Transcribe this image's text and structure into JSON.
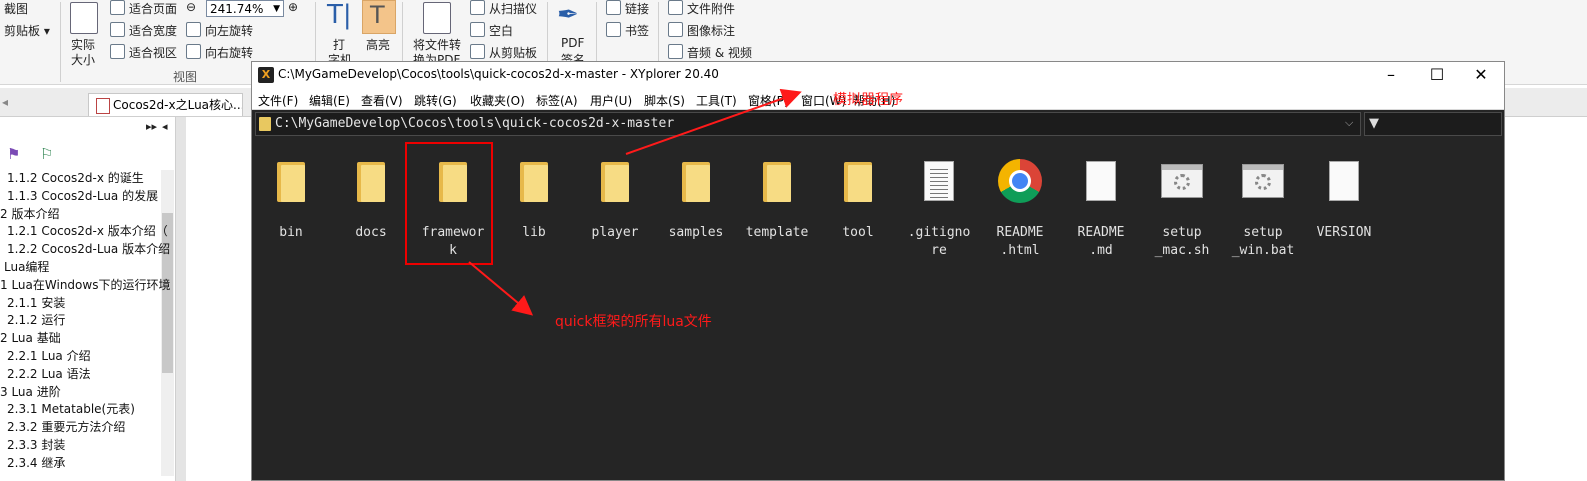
{
  "ribbon": {
    "screenshot": "截图",
    "clipboard": "剪贴板",
    "actual_size_1": "实际",
    "actual_size_2": "大小",
    "fit_page": "适合页面",
    "fit_width": "适合宽度",
    "fit_view": "适合视区",
    "zoom": "241.74%",
    "rotate_left": "向左旋转",
    "rotate_right": "向右旋转",
    "view_group": "视图",
    "typewriter_1": "打",
    "typewriter_2": "字机",
    "highlight": "高亮",
    "to_pdf_1": "将文件转",
    "to_pdf_2": "换为PDF",
    "from_scanner": "从扫描仪",
    "blank": "空白",
    "from_clipboard": "从剪贴板",
    "pdf_sign_1": "PDF",
    "pdf_sign_2": "签名",
    "link": "链接",
    "bookmark": "书签",
    "file_attachment": "文件附件",
    "image_annotation": "图像标注",
    "audio_video": "音频 & 视频"
  },
  "doc_tab": {
    "title": "Cocos2d-x之Lua核心..."
  },
  "outline": [
    "1.1.2 Cocos2d-x 的诞生",
    "1.1.3 Cocos2d-Lua 的发展",
    "2 版本介绍",
    "1.2.1 Cocos2d-x 版本介绍（",
    "1.2.2 Cocos2d-Lua 版本介绍",
    "Lua编程",
    "1 Lua在Windows下的运行环境",
    "2.1.1 安装",
    "2.1.2 运行",
    "2 Lua 基础",
    "2.2.1 Lua 介绍",
    "2.2.2 Lua 语法",
    "3 Lua 进阶",
    "2.3.1 Metatable(元表)",
    "2.3.2 重要元方法介绍",
    "2.3.3 封装",
    "2.3.4 继承"
  ],
  "window": {
    "title": "C:\\MyGameDevelop\\Cocos\\tools\\quick-cocos2d-x-master - XYplorer 20.40",
    "app_icon": "X",
    "minimize": "–",
    "maximize": "☐",
    "close": "✕"
  },
  "menu": [
    "文件(F)",
    "编辑(E)",
    "查看(V)",
    "跳转(G)",
    "收藏夹(O)",
    "标签(A)",
    "用户(U)",
    "脚本(S)",
    "工具(T)",
    "窗格(P)",
    "窗口(W)",
    "帮助(H)"
  ],
  "address": "C:\\MyGameDevelop\\Cocos\\tools\\quick-cocos2d-x-master",
  "files": [
    {
      "name": "bin",
      "type": "folder"
    },
    {
      "name": "docs",
      "type": "folder"
    },
    {
      "name": "framework",
      "label": "framewor\nk",
      "type": "folder"
    },
    {
      "name": "lib",
      "type": "folder"
    },
    {
      "name": "player",
      "type": "folder"
    },
    {
      "name": "samples",
      "type": "folder"
    },
    {
      "name": "template",
      "type": "folder"
    },
    {
      "name": "tool",
      "type": "folder"
    },
    {
      "name": ".gitignore",
      "label": ".gitigno\nre",
      "type": "text"
    },
    {
      "name": "README.html",
      "label": "README\n.html",
      "type": "chrome"
    },
    {
      "name": "README.md",
      "label": "README\n.md",
      "type": "blank"
    },
    {
      "name": "setup_mac.sh",
      "label": "setup\n_mac.sh",
      "type": "script"
    },
    {
      "name": "setup_win.bat",
      "label": "setup\n_win.bat",
      "type": "script"
    },
    {
      "name": "VERSION",
      "type": "blank"
    }
  ],
  "annotations": {
    "player_note": "模拟器程序",
    "framework_note": "quick框架的所有lua文件",
    "color": "#ff1a1a"
  },
  "colors": {
    "explorer_bg": "#252525",
    "folder": "#f7dc84",
    "highlight_tool": "#f3c48a"
  }
}
